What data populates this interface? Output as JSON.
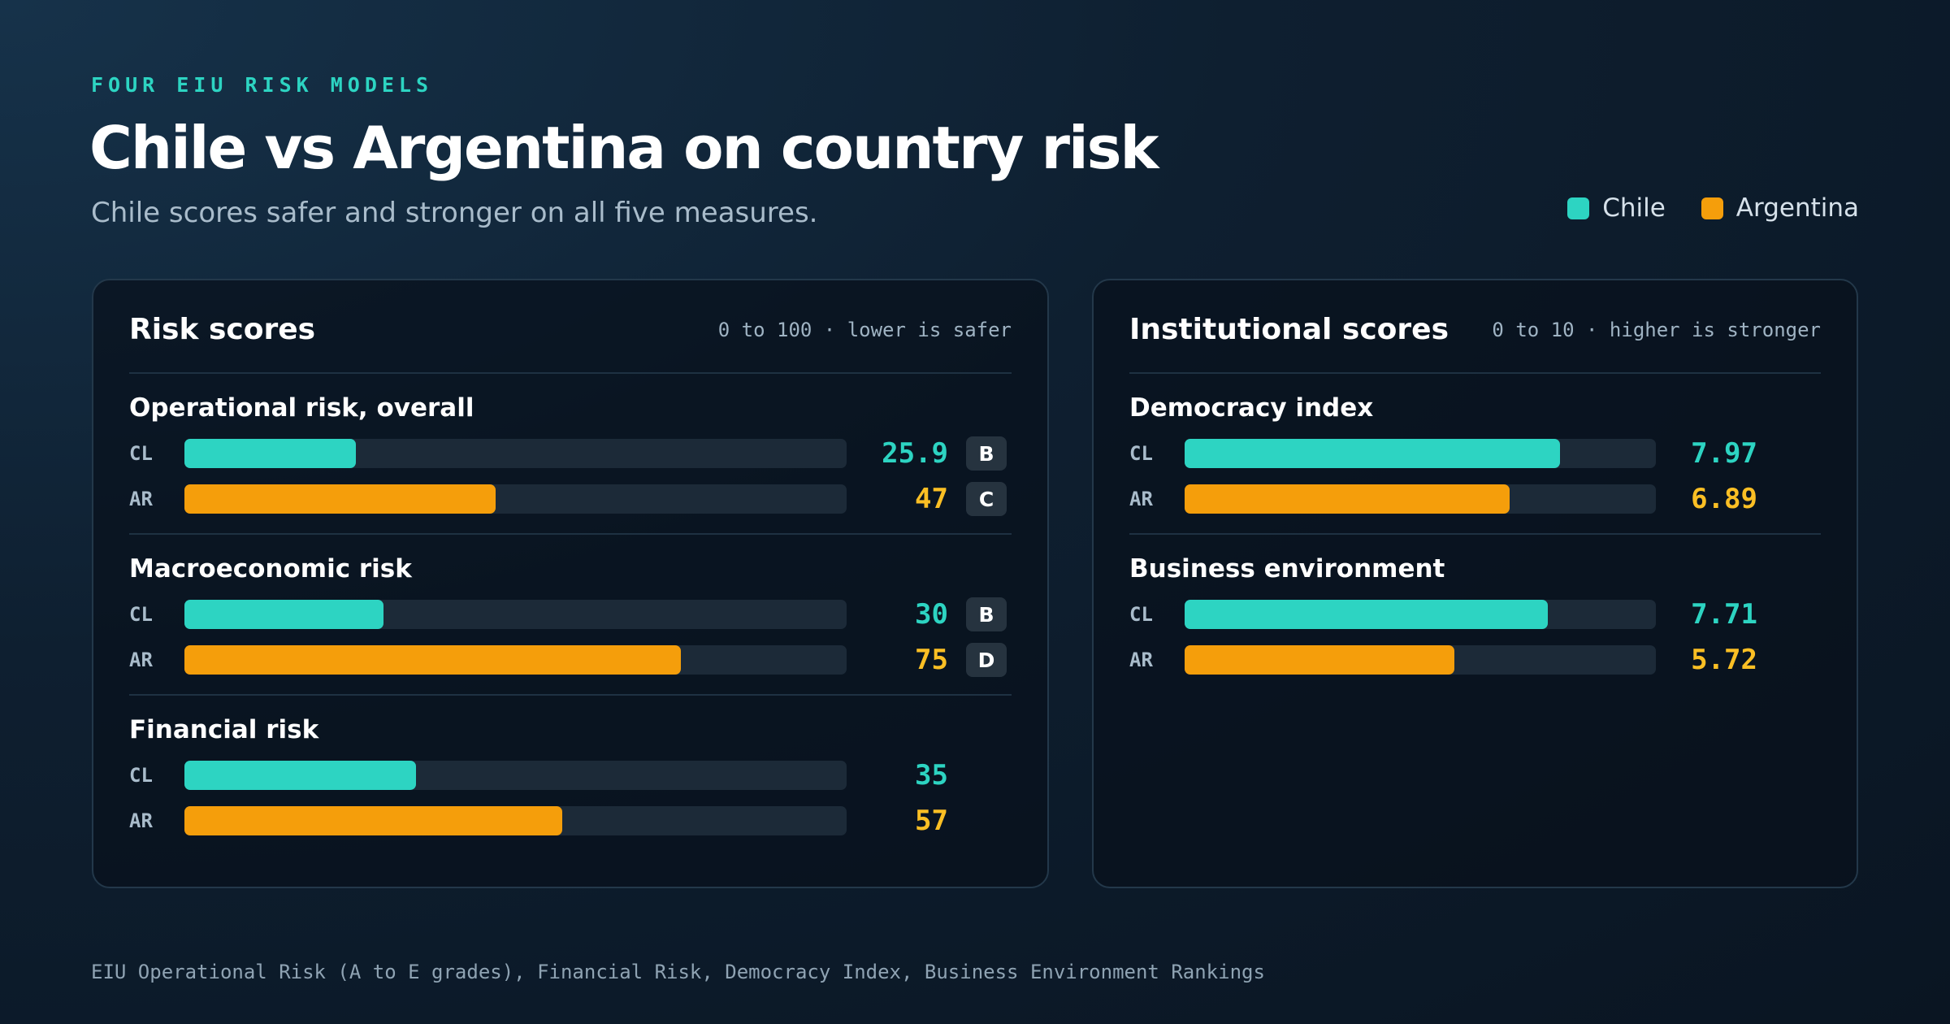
{
  "eyebrow": "FOUR EIU RISK MODELS",
  "title": "Chile vs Argentina on country risk",
  "subtitle": "Chile scores safer and stronger on all five measures.",
  "colors": {
    "chile": "#2dd4c2",
    "argentina": "#f59e0b",
    "argentina_value": "#fbbf24"
  },
  "legend": [
    {
      "name": "Chile",
      "color": "#2dd4c2"
    },
    {
      "name": "Argentina",
      "color": "#f59e0b"
    }
  ],
  "chart_data": [
    {
      "type": "bar",
      "title": "Risk scores",
      "note": "0 to 100 · lower is safer",
      "xlim": [
        0,
        100
      ],
      "groups": [
        {
          "title": "Operational risk, overall",
          "rows": [
            {
              "label": "CL",
              "value": 25.9,
              "display": "25.9",
              "grade": "B"
            },
            {
              "label": "AR",
              "value": 47,
              "display": "47",
              "grade": "C"
            }
          ]
        },
        {
          "title": "Macroeconomic risk",
          "rows": [
            {
              "label": "CL",
              "value": 30,
              "display": "30",
              "grade": "B"
            },
            {
              "label": "AR",
              "value": 75,
              "display": "75",
              "grade": "D"
            }
          ]
        },
        {
          "title": "Financial risk",
          "rows": [
            {
              "label": "CL",
              "value": 35,
              "display": "35"
            },
            {
              "label": "AR",
              "value": 57,
              "display": "57"
            }
          ]
        }
      ]
    },
    {
      "type": "bar",
      "title": "Institutional scores",
      "note": "0 to 10 · higher is stronger",
      "xlim": [
        0,
        10
      ],
      "groups": [
        {
          "title": "Democracy index",
          "rows": [
            {
              "label": "CL",
              "value": 7.97,
              "display": "7.97"
            },
            {
              "label": "AR",
              "value": 6.89,
              "display": "6.89"
            }
          ]
        },
        {
          "title": "Business environment",
          "rows": [
            {
              "label": "CL",
              "value": 7.71,
              "display": "7.71"
            },
            {
              "label": "AR",
              "value": 5.72,
              "display": "5.72"
            }
          ]
        }
      ]
    }
  ],
  "footer": "EIU Operational Risk (A to E grades), Financial Risk, Democracy Index, Business Environment Rankings"
}
